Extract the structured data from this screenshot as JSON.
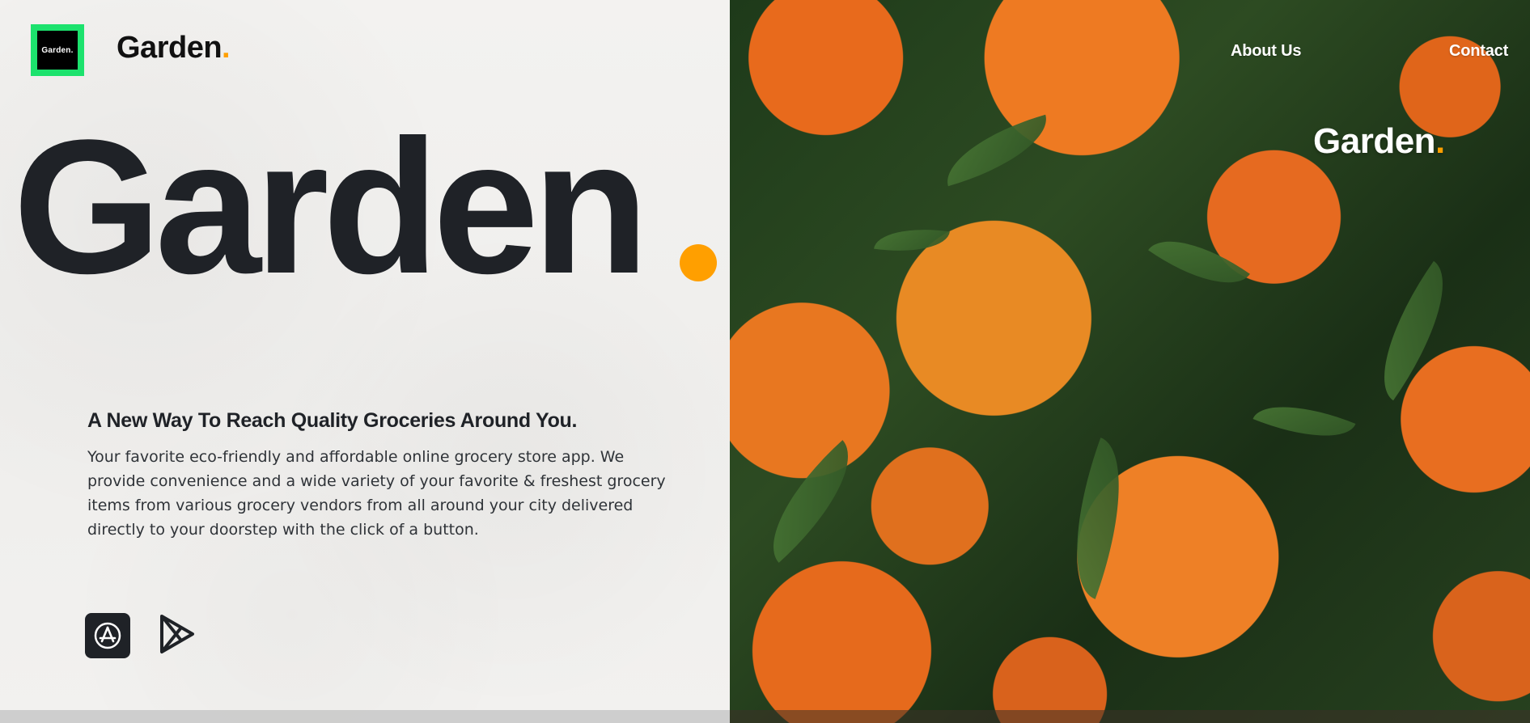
{
  "header": {
    "logo_text": "Garden.",
    "brand_name": "Garden",
    "brand_dot": "."
  },
  "nav": {
    "about_label": "About Us",
    "contact_label": "Contact"
  },
  "hero": {
    "title": "Garden",
    "tagline": "A New Way To Reach Quality Groceries Around You.",
    "description": "Your favorite eco-friendly and affordable online grocery store app. We provide convenience and a wide variety of your favorite & freshest grocery items from various grocery vendors from all around your city delivered directly to your doorstep with the click of a button."
  },
  "right_panel": {
    "brand_name": "Garden",
    "brand_dot": "."
  },
  "downloads": [
    {
      "name": "App Store",
      "icon": "app-store-icon"
    },
    {
      "name": "Google Play",
      "icon": "google-play-icon"
    }
  ],
  "colors": {
    "accent_orange": "#ff9f00",
    "logo_green": "#1ce26d",
    "dark_text": "#1f2227"
  }
}
